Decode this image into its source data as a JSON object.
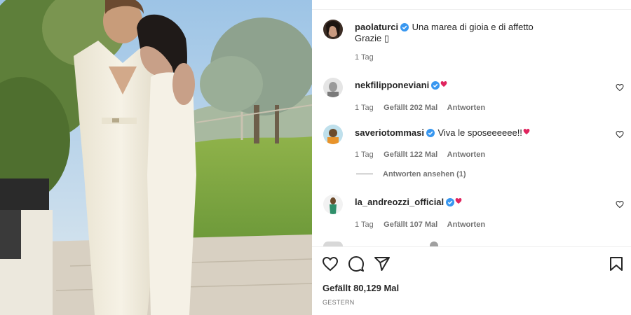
{
  "post": {
    "author": "paolaturci",
    "caption_line1": "Una marea di gioia e di affetto",
    "caption_line2": "Grazie ▯",
    "time": "1 Tag"
  },
  "comments": [
    {
      "user": "nekfilipponeviani",
      "text": "",
      "time": "1 Tag",
      "likes": "Gefällt 202 Mal",
      "reply": "Antworten"
    },
    {
      "user": "saveriotommasi",
      "text": "Viva le sposeeeeee!!",
      "time": "1 Tag",
      "likes": "Gefällt 122 Mal",
      "reply": "Antworten"
    },
    {
      "user": "la_andreozzi_official",
      "text": "",
      "time": "1 Tag",
      "likes": "Gefällt 107 Mal",
      "reply": "Antworten"
    }
  ],
  "view_replies": "Antworten ansehen (1)",
  "actions": {
    "like_icon": "heart-icon",
    "comment_icon": "comment-icon",
    "share_icon": "share-icon",
    "save_icon": "bookmark-icon"
  },
  "likes_total": "Gefällt 80,129 Mal",
  "date_label": "GESTERN",
  "colors": {
    "verified": "#3897f0",
    "emoji_heart": "#e0245e",
    "muted_text": "#737373"
  }
}
